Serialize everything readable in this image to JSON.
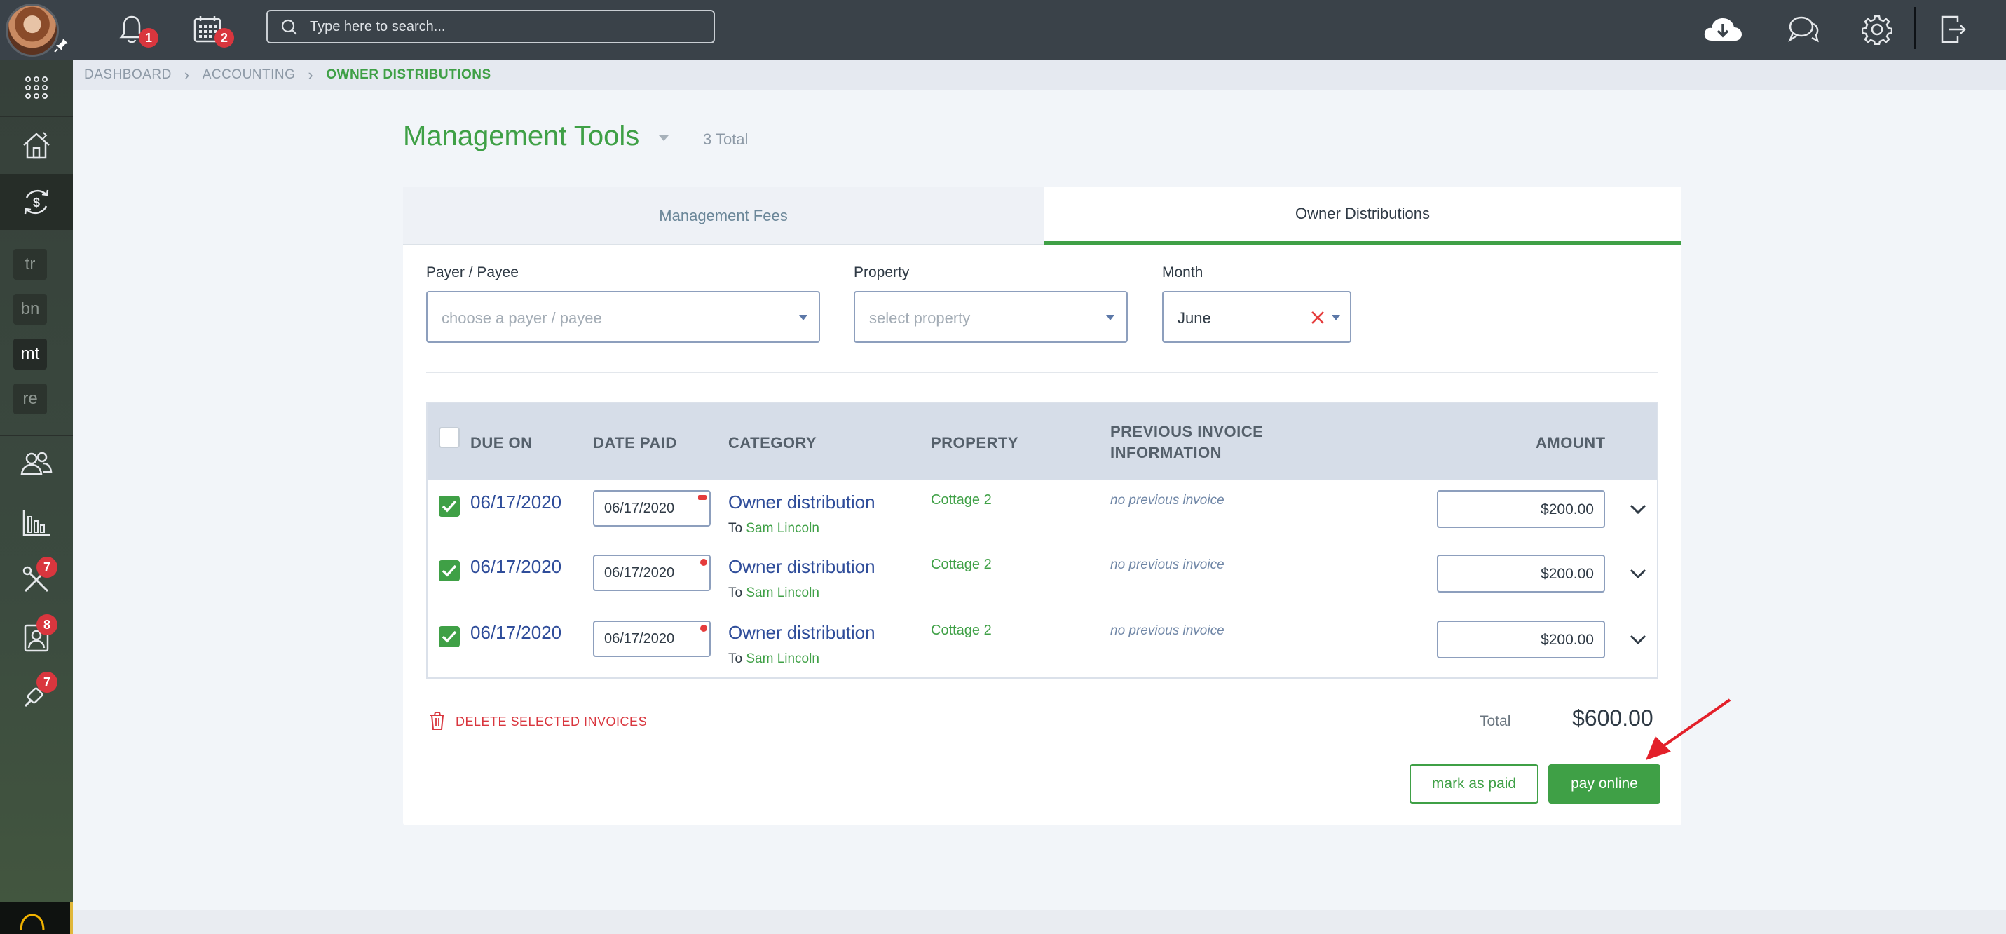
{
  "topbar": {
    "notifications_badge": "1",
    "calendar_badge": "2",
    "search_placeholder": "Type here to search..."
  },
  "sidebar": {
    "text_items": [
      "tr",
      "bn",
      "mt",
      "re"
    ],
    "badges": {
      "tools": "7",
      "contacts": "8",
      "marketing": "7"
    }
  },
  "breadcrumb": {
    "items": [
      "DASHBOARD",
      "ACCOUNTING"
    ],
    "current": "OWNER DISTRIBUTIONS"
  },
  "header": {
    "title": "Management Tools",
    "total": "3 Total"
  },
  "tabs": [
    {
      "label": "Management Fees",
      "active": false
    },
    {
      "label": "Owner Distributions",
      "active": true
    }
  ],
  "filters": {
    "payer_label": "Payer / Payee",
    "payer_placeholder": "choose a payer / payee",
    "property_label": "Property",
    "property_placeholder": "select property",
    "month_label": "Month",
    "month_value": "June"
  },
  "table": {
    "headers": {
      "due_on": "DUE ON",
      "date_paid": "DATE PAID",
      "category": "CATEGORY",
      "property": "PROPERTY",
      "previous_line1": "PREVIOUS INVOICE",
      "previous_line2": "INFORMATION",
      "amount": "AMOUNT"
    },
    "rows": [
      {
        "due_on": "06/17/2020",
        "date_paid": "06/17/2020",
        "category": "Owner distribution",
        "to_prefix": "To",
        "to_name": "Sam Lincoln",
        "property": "Cottage 2",
        "previous": "no previous invoice",
        "amount": "$200.00",
        "checked": true
      },
      {
        "due_on": "06/17/2020",
        "date_paid": "06/17/2020",
        "category": "Owner distribution",
        "to_prefix": "To",
        "to_name": "Sam Lincoln",
        "property": "Cottage 2",
        "previous": "no previous invoice",
        "amount": "$200.00",
        "checked": true
      },
      {
        "due_on": "06/17/2020",
        "date_paid": "06/17/2020",
        "category": "Owner distribution",
        "to_prefix": "To",
        "to_name": "Sam Lincoln",
        "property": "Cottage 2",
        "previous": "no previous invoice",
        "amount": "$200.00",
        "checked": true
      }
    ]
  },
  "footer": {
    "delete_label": "DELETE SELECTED INVOICES",
    "total_label": "Total",
    "total_value": "$600.00",
    "mark_paid_label": "mark as paid",
    "pay_online_label": "pay online"
  },
  "colors": {
    "accent_green": "#3fa046",
    "link_blue": "#2f4d9a",
    "badge_red": "#d9363e",
    "topbar": "#3a4249",
    "annotation_arrow": "#e3202a"
  }
}
